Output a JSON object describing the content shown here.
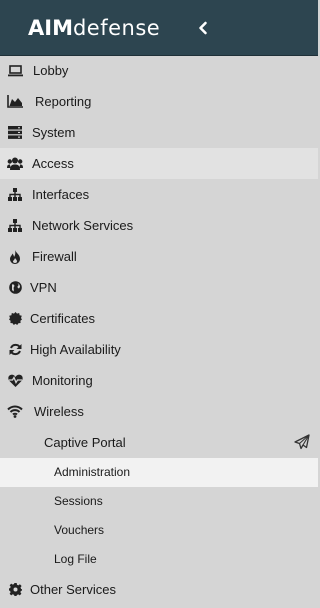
{
  "brand": {
    "part1": "AIM",
    "part2": "defense"
  },
  "menu": [
    {
      "label": "Lobby",
      "icon": "laptop-icon"
    },
    {
      "label": "Reporting",
      "icon": "area-chart-icon"
    },
    {
      "label": "System",
      "icon": "server-icon"
    },
    {
      "label": "Access",
      "icon": "users-icon",
      "active": true
    },
    {
      "label": "Interfaces",
      "icon": "sitemap-icon"
    },
    {
      "label": "Network Services",
      "icon": "sitemap-icon"
    },
    {
      "label": "Firewall",
      "icon": "fire-icon"
    },
    {
      "label": "VPN",
      "icon": "globe-icon"
    },
    {
      "label": "Certificates",
      "icon": "certificate-icon"
    },
    {
      "label": "High Availability",
      "icon": "refresh-icon"
    },
    {
      "label": "Monitoring",
      "icon": "heartbeat-icon"
    },
    {
      "label": "Wireless",
      "icon": "wifi-icon"
    }
  ],
  "submenu": {
    "label": "Captive Portal",
    "icon": "paper-plane-icon",
    "items": [
      {
        "label": "Administration",
        "selected": true
      },
      {
        "label": "Sessions"
      },
      {
        "label": "Vouchers"
      },
      {
        "label": "Log File"
      }
    ]
  },
  "other": {
    "label": "Other Services",
    "icon": "cog-icon"
  },
  "colors": {
    "header_bg": "#2d4550",
    "sidebar_bg": "#d5d5d5",
    "active_bg": "#e2e2e2",
    "selected_bg": "#f2f2f2"
  }
}
